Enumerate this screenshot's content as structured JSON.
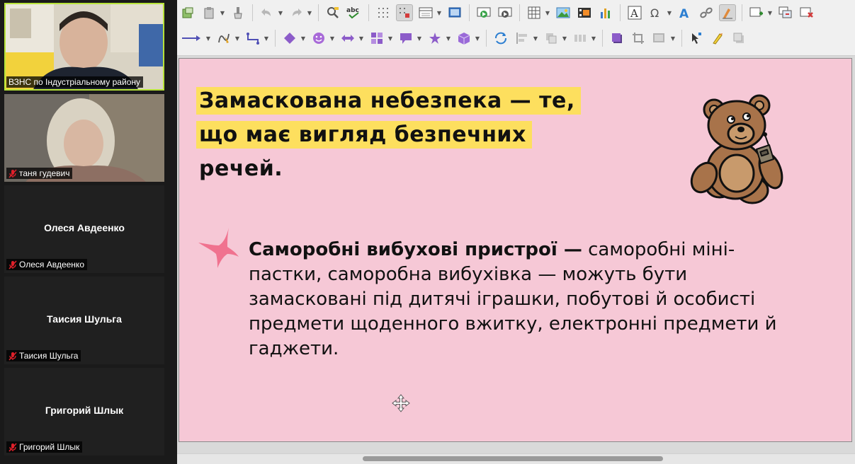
{
  "participants": [
    {
      "name": "ВЗНС по Індустріальному району",
      "video": true,
      "active": true,
      "muted": false
    },
    {
      "name": "таня гудевич",
      "video": true,
      "active": false,
      "muted": true
    },
    {
      "name": "Олеся Авдеенко",
      "video": false,
      "active": false,
      "muted": true
    },
    {
      "name": "Таисия Шульга",
      "video": false,
      "active": false,
      "muted": true
    },
    {
      "name": "Григорий Шлык",
      "video": false,
      "active": false,
      "muted": true
    }
  ],
  "slide": {
    "heading_lines": [
      "Замаскована небезпека — те,",
      "що має вигляд безпечних",
      "речей."
    ],
    "body_bold": "Саморобні вибухові пристрої —",
    "body_rest": " саморобні міні-пастки, саморобна вибухівка — можуть бути замасковані під дитячі іграшки, побутові й особисті предмети щоденного вжитку, електронні предмети й гаджети.",
    "background_color": "#f6c8d6",
    "highlight_color": "#fddf5e",
    "star_color": "#f0728f"
  },
  "toolbar": {
    "row1_icons": [
      "clone-formatting-icon",
      "paste-icon",
      "paint-brush-icon",
      "undo-icon",
      "redo-icon",
      "find-replace-icon",
      "spellcheck-icon",
      "grid-icon",
      "snap-icon",
      "display-views-icon",
      "master-slide-icon",
      "start-slideshow-icon",
      "slideshow-current-icon",
      "table-icon",
      "image-icon",
      "media-icon",
      "chart-icon",
      "text-box-icon",
      "special-character-icon",
      "fontwork-icon",
      "hyperlink-icon",
      "draw-function-icon",
      "new-slide-icon",
      "duplicate-slide-icon",
      "delete-slide-icon"
    ],
    "row2_icons": [
      "line-arrow-icon",
      "curve-icon",
      "connector-icon",
      "basic-shapes-icon",
      "symbol-shapes-icon",
      "block-arrows-icon",
      "flowchart-icon",
      "callouts-icon",
      "stars-icon",
      "3d-objects-icon",
      "rotate-icon",
      "align-icon",
      "arrange-icon",
      "distribute-icon",
      "shadow-icon",
      "crop-icon",
      "filter-icon",
      "points-icon",
      "glue-points-icon",
      "toggle-extrusion-icon"
    ]
  },
  "scrollbar": {
    "position_fraction": 0.27,
    "visible_fraction": 0.44
  }
}
